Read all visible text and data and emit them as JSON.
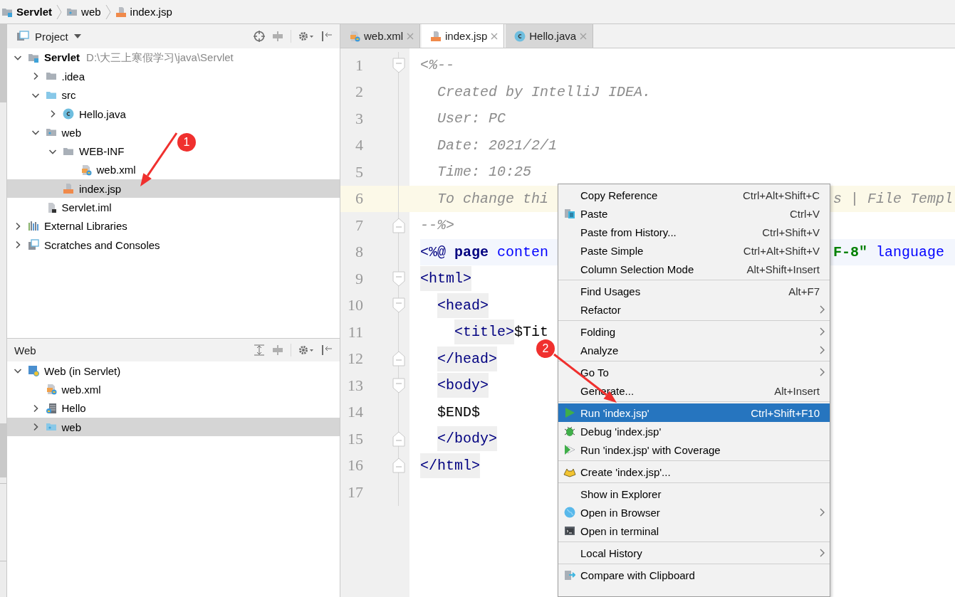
{
  "breadcrumb": [
    {
      "label": "Servlet",
      "kind": "module"
    },
    {
      "label": "web",
      "kind": "web-folder"
    },
    {
      "label": "index.jsp",
      "kind": "jsp"
    }
  ],
  "tool_window_stripe": [
    {
      "selected": true
    },
    {
      "selected": true
    },
    {
      "selected": false
    }
  ],
  "panels": [
    {
      "kind": "project",
      "title": "Project",
      "tree": [
        {
          "label": "Servlet",
          "detail": "D:\\大三上寒假学习\\java\\Servlet",
          "kind": "module",
          "selected": false,
          "expanded": true,
          "children": [
            {
              "label": ".idea",
              "kind": "folder",
              "selected": false,
              "expanded": false
            },
            {
              "label": "src",
              "kind": "source-folder",
              "selected": false,
              "expanded": true,
              "children": [
                {
                  "label": "Hello.java",
                  "kind": "class",
                  "selected": false,
                  "expanded": false
                }
              ]
            },
            {
              "label": "web",
              "kind": "web-folder",
              "selected": false,
              "expanded": true,
              "children": [
                {
                  "label": "WEB-INF",
                  "kind": "folder",
                  "selected": false,
                  "expanded": true,
                  "children": [
                    {
                      "label": "web.xml",
                      "kind": "xml",
                      "selected": false
                    }
                  ]
                },
                {
                  "label": "index.jsp",
                  "kind": "jsp",
                  "selected": true
                }
              ]
            },
            {
              "label": "Servlet.iml",
              "kind": "iml",
              "selected": false
            }
          ]
        },
        {
          "label": "External Libraries",
          "kind": "libraries",
          "selected": false,
          "expanded": false
        },
        {
          "label": "Scratches and Consoles",
          "kind": "scratches",
          "selected": false,
          "expanded": false
        }
      ]
    },
    {
      "kind": "web",
      "title": "Web",
      "tree": [
        {
          "label": "Web (in Servlet)",
          "kind": "web-facet",
          "selected": false,
          "expanded": true,
          "children": [
            {
              "label": "web.xml",
              "kind": "xml",
              "selected": false
            },
            {
              "label": "Hello",
              "kind": "servlet",
              "selected": false,
              "expanded": false
            },
            {
              "label": "web",
              "kind": "web-root",
              "selected": true,
              "expanded": false
            }
          ]
        }
      ]
    }
  ],
  "editor": {
    "tabs": [
      {
        "label": "web.xml",
        "kind": "xml",
        "selected": false
      },
      {
        "label": "index.jsp",
        "kind": "jsp",
        "selected": true
      },
      {
        "label": "Hello.java",
        "kind": "class",
        "selected": false
      }
    ],
    "lines": [
      {
        "number": "1",
        "kind": "code",
        "current": false,
        "fold_start": true,
        "fold_end": false,
        "tokens": [
          {
            "kind": "comment",
            "text": "<%--"
          }
        ]
      },
      {
        "number": "2",
        "kind": "code",
        "current": false,
        "fold_start": false,
        "fold_end": false,
        "tokens": [
          {
            "kind": "comment",
            "text": "  Created by IntelliJ IDEA."
          }
        ]
      },
      {
        "number": "3",
        "kind": "code",
        "current": false,
        "fold_start": false,
        "fold_end": false,
        "tokens": [
          {
            "kind": "comment",
            "text": "  User: PC"
          }
        ]
      },
      {
        "number": "4",
        "kind": "code",
        "current": false,
        "fold_start": false,
        "fold_end": false,
        "tokens": [
          {
            "kind": "comment",
            "text": "  Date: 2021/2/1"
          }
        ]
      },
      {
        "number": "5",
        "kind": "code",
        "current": false,
        "fold_start": false,
        "fold_end": false,
        "tokens": [
          {
            "kind": "comment",
            "text": "  Time: 10:25"
          }
        ]
      },
      {
        "number": "6",
        "kind": "code",
        "current": true,
        "fold_start": false,
        "fold_end": false,
        "tokens": [
          {
            "kind": "comment",
            "text": "  To change thi"
          }
        ],
        "right": [
          {
            "kind": "comment",
            "text": "s | File Templ"
          }
        ]
      },
      {
        "number": "7",
        "kind": "code",
        "current": false,
        "fold_start": false,
        "fold_end": true,
        "tokens": [
          {
            "kind": "comment",
            "text": "--%>"
          }
        ]
      },
      {
        "number": "8",
        "kind": "directive",
        "current": false,
        "fold_start": false,
        "fold_end": false,
        "tokens": [
          {
            "kind": "tag",
            "text": "<%@"
          },
          {
            "kind": "keyword",
            "text": " page"
          },
          {
            "kind": "attr",
            "text": " conten"
          }
        ],
        "right": [
          {
            "kind": "string",
            "text": "F-8″"
          },
          {
            "kind": "attr",
            "text": " language"
          }
        ]
      },
      {
        "number": "9",
        "kind": "code",
        "current": false,
        "fold_start": true,
        "fold_end": false,
        "tokens": [
          {
            "kind": "tag-box",
            "text": "<html>"
          }
        ]
      },
      {
        "number": "10",
        "kind": "code",
        "current": false,
        "fold_start": true,
        "fold_end": false,
        "tokens": [
          {
            "kind": "tag-box",
            "text": "  <head>"
          }
        ]
      },
      {
        "number": "11",
        "kind": "code",
        "current": false,
        "fold_start": false,
        "fold_end": false,
        "tokens": [
          {
            "kind": "tag-box",
            "text": "    <title>"
          },
          {
            "kind": "text",
            "text": "$Tit"
          }
        ]
      },
      {
        "number": "12",
        "kind": "code",
        "current": false,
        "fold_start": false,
        "fold_end": true,
        "tokens": [
          {
            "kind": "tag-box",
            "text": "  </head>"
          }
        ]
      },
      {
        "number": "13",
        "kind": "code",
        "current": false,
        "fold_start": true,
        "fold_end": false,
        "tokens": [
          {
            "kind": "tag-box",
            "text": "  <body>"
          }
        ]
      },
      {
        "number": "14",
        "kind": "code",
        "current": false,
        "fold_start": false,
        "fold_end": false,
        "tokens": [
          {
            "kind": "text",
            "text": "  $END$"
          }
        ]
      },
      {
        "number": "15",
        "kind": "code",
        "current": false,
        "fold_start": false,
        "fold_end": true,
        "tokens": [
          {
            "kind": "tag-box",
            "text": "  </body>"
          }
        ]
      },
      {
        "number": "16",
        "kind": "code",
        "current": false,
        "fold_start": false,
        "fold_end": true,
        "tokens": [
          {
            "kind": "tag-box",
            "text": "</html>"
          }
        ]
      },
      {
        "number": "17",
        "kind": "code",
        "current": false,
        "fold_start": false,
        "fold_end": false
      }
    ]
  },
  "context_menu": {
    "groups": [
      [
        {
          "label": "Copy Reference",
          "shortcut": "Ctrl+Alt+Shift+C",
          "kind": "plain",
          "submenu": false,
          "selected": false,
          "disabled": false
        },
        {
          "label": "Paste",
          "shortcut": "Ctrl+V",
          "kind": "paste",
          "submenu": false,
          "selected": false,
          "disabled": false
        },
        {
          "label": "Paste from History...",
          "shortcut": "Ctrl+Shift+V",
          "kind": "plain",
          "submenu": false,
          "selected": false,
          "disabled": false
        },
        {
          "label": "Paste Simple",
          "shortcut": "Ctrl+Alt+Shift+V",
          "kind": "plain",
          "submenu": false,
          "selected": false,
          "disabled": false
        },
        {
          "label": "Column Selection Mode",
          "shortcut": "Alt+Shift+Insert",
          "kind": "plain",
          "submenu": false,
          "selected": false,
          "disabled": false
        }
      ],
      [
        {
          "label": "Find Usages",
          "shortcut": "Alt+F7",
          "kind": "plain",
          "submenu": false,
          "selected": false,
          "disabled": false
        },
        {
          "label": "Refactor",
          "kind": "plain",
          "submenu": true,
          "selected": false,
          "disabled": false
        }
      ],
      [
        {
          "label": "Folding",
          "kind": "plain",
          "submenu": true,
          "selected": false,
          "disabled": false
        },
        {
          "label": "Analyze",
          "kind": "plain",
          "submenu": true,
          "selected": false,
          "disabled": false
        }
      ],
      [
        {
          "label": "Go To",
          "kind": "plain",
          "submenu": true,
          "selected": false,
          "disabled": false
        },
        {
          "label": "Generate...",
          "shortcut": "Alt+Insert",
          "kind": "plain",
          "submenu": false,
          "selected": false,
          "disabled": false
        }
      ],
      [
        {
          "label": "Run 'index.jsp'",
          "shortcut": "Ctrl+Shift+F10",
          "kind": "run",
          "submenu": false,
          "selected": true,
          "disabled": false
        },
        {
          "label": "Debug 'index.jsp'",
          "kind": "debug",
          "submenu": false,
          "selected": false,
          "disabled": false
        },
        {
          "label": "Run 'index.jsp' with Coverage",
          "kind": "coverage",
          "submenu": false,
          "selected": false,
          "disabled": false
        }
      ],
      [
        {
          "label": "Create 'index.jsp'...",
          "kind": "create",
          "submenu": false,
          "selected": false,
          "disabled": false
        }
      ],
      [
        {
          "label": "Show in Explorer",
          "kind": "plain",
          "submenu": false,
          "selected": false,
          "disabled": false
        },
        {
          "label": "Open in Browser",
          "kind": "browser",
          "submenu": true,
          "selected": false,
          "disabled": false
        },
        {
          "label": "Open in terminal",
          "kind": "terminal",
          "submenu": false,
          "selected": false,
          "disabled": false
        }
      ],
      [
        {
          "label": "Local History",
          "kind": "plain",
          "submenu": true,
          "selected": false,
          "disabled": false
        }
      ],
      [
        {
          "label": "Compare with Clipboard",
          "kind": "compare",
          "submenu": false,
          "selected": false,
          "disabled": false
        }
      ]
    ]
  },
  "annotations": [
    {
      "label": "1"
    },
    {
      "label": "2"
    }
  ]
}
